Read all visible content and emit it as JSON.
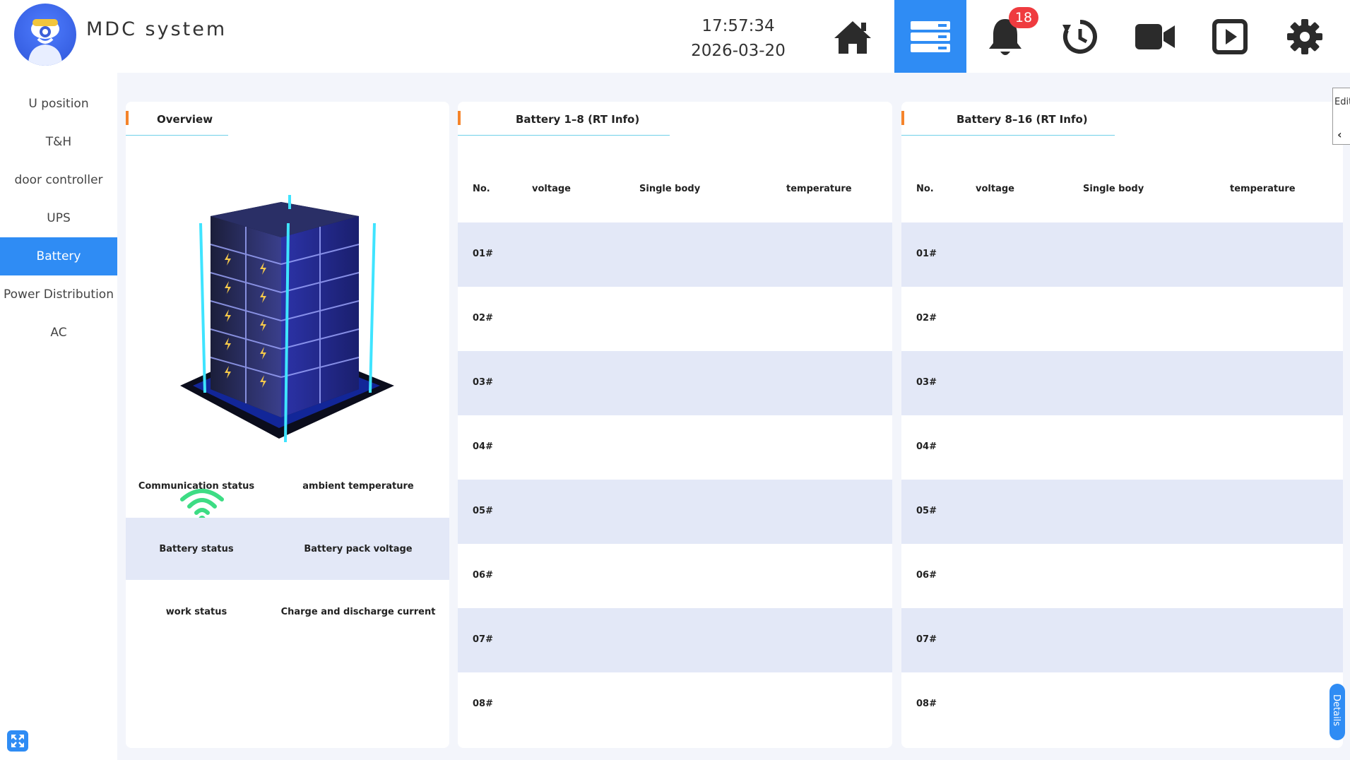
{
  "header": {
    "app_title": "MDC system",
    "time": "17:57:34",
    "date": "2026-03-20",
    "notification_count": "18",
    "accent_color": "#2f8cf4",
    "nav_icons": [
      "home-icon",
      "server-list-icon",
      "bell-icon",
      "history-icon",
      "video-camera-icon",
      "play-icon",
      "gear-icon"
    ],
    "active_nav": "server-list-icon"
  },
  "sidebar": {
    "items": [
      {
        "label": "U position"
      },
      {
        "label": "T&H"
      },
      {
        "label": "door controller"
      },
      {
        "label": "UPS"
      },
      {
        "label": "Battery"
      },
      {
        "label": "Power Distribution"
      },
      {
        "label": "AC"
      }
    ],
    "active": "Battery"
  },
  "overview": {
    "title": "Overview",
    "rows": [
      {
        "left": "Communication status",
        "right": "ambient temperature"
      },
      {
        "left": "Battery status",
        "right": "Battery pack voltage"
      },
      {
        "left": "work status",
        "right": "Charge and discharge current"
      }
    ]
  },
  "battery_a": {
    "title": "Battery 1–8 (RT Info)",
    "columns": [
      "No.",
      "voltage",
      "Single body",
      "temperature"
    ],
    "rows": [
      "01#",
      "02#",
      "03#",
      "04#",
      "05#",
      "06#",
      "07#",
      "08#"
    ]
  },
  "battery_b": {
    "title": "Battery 8–16 (RT Info)",
    "columns": [
      "No.",
      "voltage",
      "Single body",
      "temperature"
    ],
    "rows": [
      "01#",
      "02#",
      "03#",
      "04#",
      "05#",
      "06#",
      "07#",
      "08#"
    ]
  },
  "side_tabs": {
    "edit": "Edit",
    "details": "Details"
  }
}
